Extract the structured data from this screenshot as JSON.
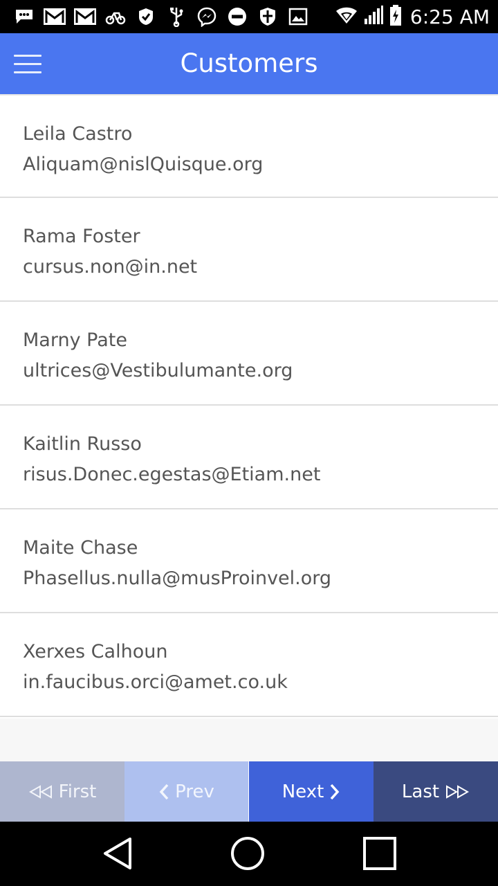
{
  "status_bar": {
    "time": "6:25 AM",
    "left_icons": [
      "chat-bubble-icon",
      "gmail-icon",
      "gmail-icon",
      "bike-icon",
      "check-badge-icon",
      "usb-icon",
      "messenger-icon",
      "do-not-disturb-icon",
      "shield-icon",
      "image-icon"
    ],
    "right_icons": [
      "wifi-icon",
      "cell-signal-icon",
      "battery-charging-icon"
    ]
  },
  "app_bar": {
    "title": "Customers",
    "menu_icon": "hamburger-menu-icon",
    "color": "#4a76f0"
  },
  "customers": [
    {
      "name": "Leila Castro",
      "email": "Aliquam@nislQuisque.org"
    },
    {
      "name": "Rama Foster",
      "email": "cursus.non@in.net"
    },
    {
      "name": "Marny Pate",
      "email": "ultrices@Vestibulumante.org"
    },
    {
      "name": "Kaitlin Russo",
      "email": "risus.Donec.egestas@Etiam.net"
    },
    {
      "name": "Maite Chase",
      "email": "Phasellus.nulla@musProinvel.org"
    },
    {
      "name": "Xerxes Calhoun",
      "email": "in.faucibus.orci@amet.co.uk"
    }
  ],
  "pagination": {
    "first_label": "First",
    "prev_label": "Prev",
    "next_label": "Next",
    "last_label": "Last",
    "colors": {
      "first": "#aeb6cf",
      "prev": "#aec0ef",
      "next": "#3f62d9",
      "last": "#3a4a80"
    }
  },
  "nav_bar": {
    "icons": [
      "back-triangle-icon",
      "home-circle-icon",
      "recents-square-icon"
    ]
  }
}
